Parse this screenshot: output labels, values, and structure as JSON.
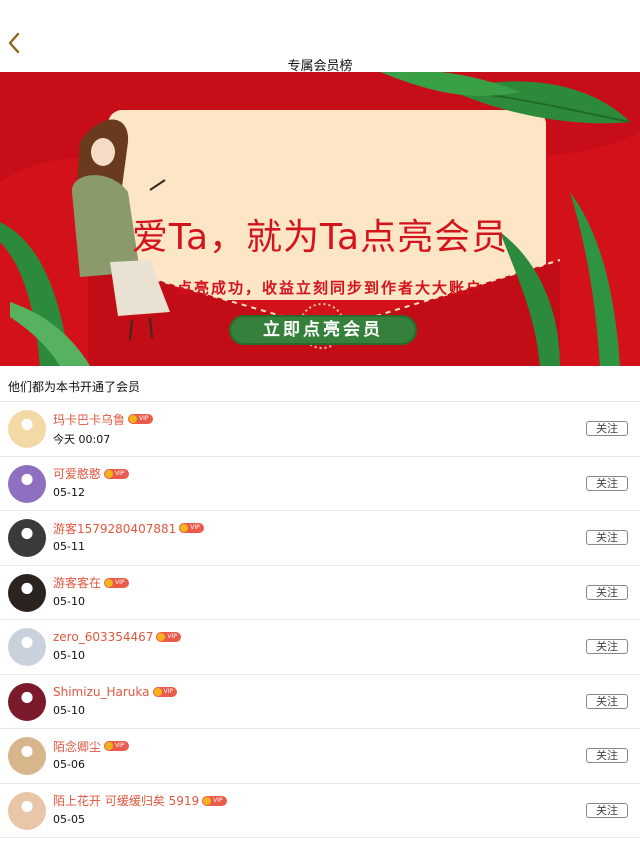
{
  "header": {
    "title": "专属会员榜",
    "back_icon": "chevron-left-icon"
  },
  "banner": {
    "headline": "爱Ta，就为Ta点亮会员",
    "subtitle": "点亮成功，收益立刻同步到作者大大账户",
    "cta_label": "立即点亮会员",
    "colors": {
      "background": "#d3111b",
      "card": "#fde6c6",
      "accent_green": "#35803a"
    }
  },
  "section": {
    "title": "他们都为本书开通了会员"
  },
  "vip_label": "VIP",
  "follow_label": "关注",
  "members": [
    {
      "name": "玛卡巴卡乌鲁",
      "date": "今天 00:07",
      "avatar_color": "#f3d9a6"
    },
    {
      "name": "可爱憨憨",
      "date": "05-12",
      "avatar_color": "#8e6fc2"
    },
    {
      "name": "游客1579280407881",
      "date": "05-11",
      "avatar_color": "#3a3a3a"
    },
    {
      "name": "游客客在",
      "date": "05-10",
      "avatar_color": "#2a2320"
    },
    {
      "name": "zero_603354467",
      "date": "05-10",
      "avatar_color": "#c9d2dc"
    },
    {
      "name": "Shimizu_Haruka",
      "date": "05-10",
      "avatar_color": "#7a1a2a"
    },
    {
      "name": "陌念卿尘",
      "date": "05-06",
      "avatar_color": "#d8b68c"
    },
    {
      "name": "陌上花开 可缓缓归矣 5919",
      "date": "05-05",
      "avatar_color": "#e9c6a8"
    }
  ]
}
